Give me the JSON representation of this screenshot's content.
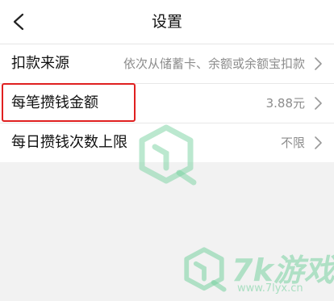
{
  "header": {
    "title": "设置"
  },
  "rows": [
    {
      "label": "扣款来源",
      "value": "依次从储蓄卡、余额或余额宝扣款"
    },
    {
      "label": "每笔攒钱金额",
      "value": "3.88元"
    },
    {
      "label": "每日攒钱次数上限",
      "value": "不限"
    }
  ],
  "watermark": {
    "brand": "7k游戏",
    "url": "www.7lyx.cn"
  },
  "colors": {
    "highlight": "#e02020",
    "watermark": "#78d2a0"
  }
}
